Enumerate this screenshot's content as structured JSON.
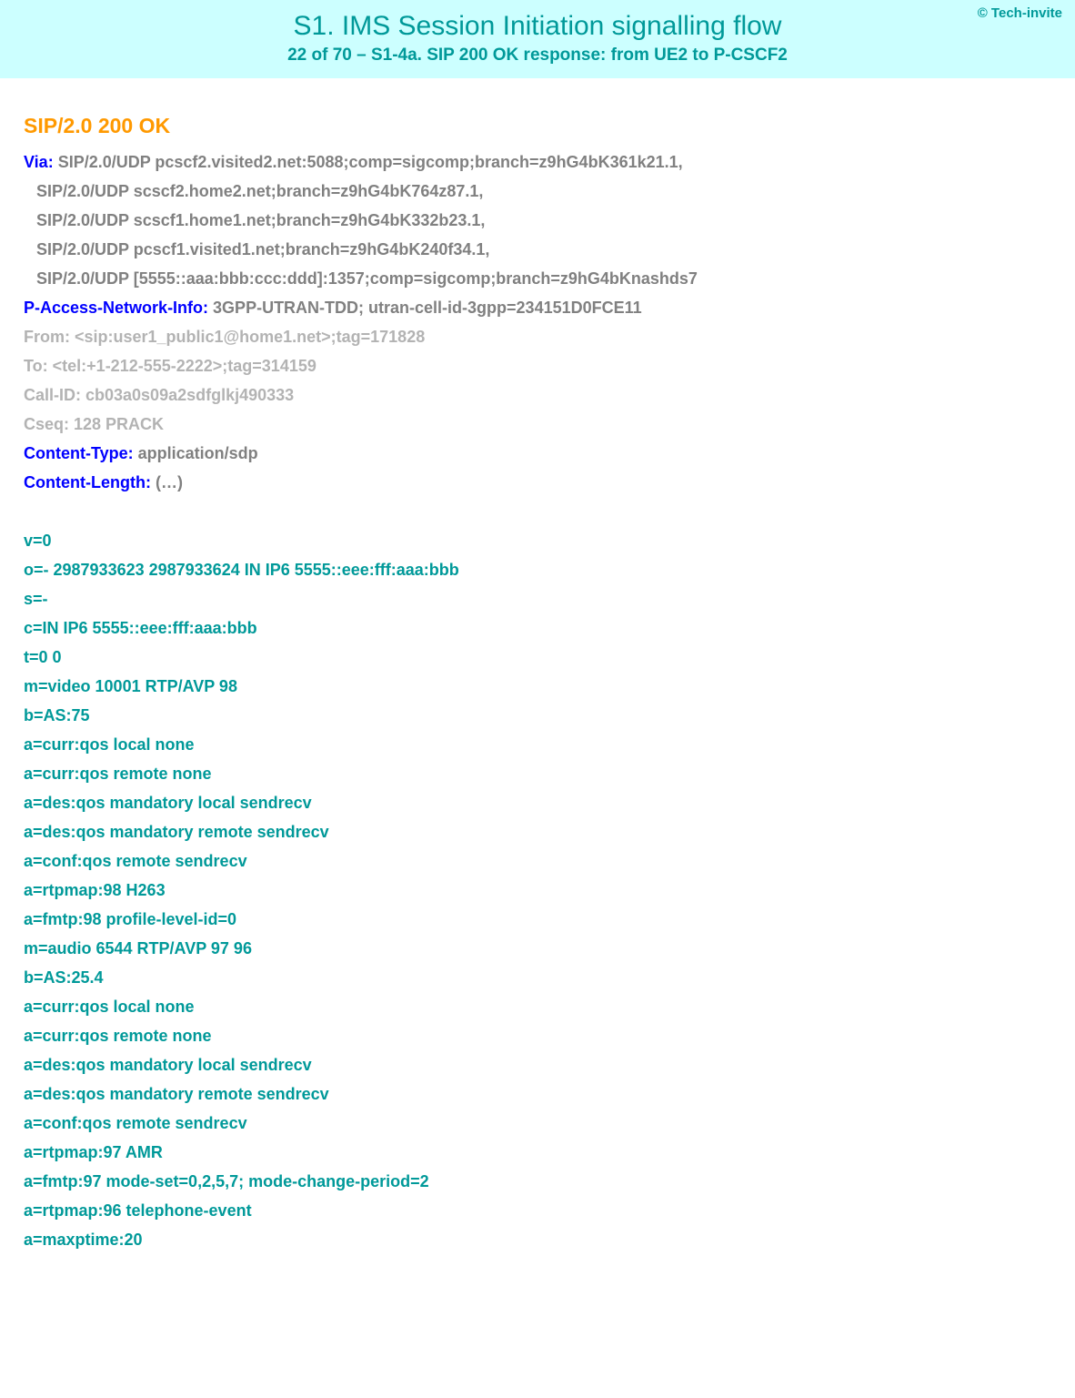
{
  "header": {
    "copyright": "© Tech-invite",
    "title": "S1. IMS Session Initiation signalling flow",
    "subtitle": "22 of 70 – S1-4a. SIP 200 OK response: from UE2 to P-CSCF2"
  },
  "sip": {
    "status_line": "SIP/2.0 200 OK",
    "via_label": "Via:",
    "via_first_value": " SIP/2.0/UDP pcscf2.visited2.net:5088;comp=sigcomp;branch=z9hG4bK361k21.1,",
    "via_cont": [
      "SIP/2.0/UDP scscf2.home2.net;branch=z9hG4bK764z87.1,",
      "SIP/2.0/UDP scscf1.home1.net;branch=z9hG4bK332b23.1,",
      "SIP/2.0/UDP pcscf1.visited1.net;branch=z9hG4bK240f34.1,",
      "SIP/2.0/UDP [5555::aaa:bbb:ccc:ddd]:1357;comp=sigcomp;branch=z9hG4bKnashds7"
    ],
    "pani_label": "P-Access-Network-Info:",
    "pani_value": " 3GPP-UTRAN-TDD; utran-cell-id-3gpp=234151D0FCE11",
    "from_label": "From:",
    "from_value": " <sip:user1_public1@home1.net>;tag=171828",
    "to_label": "To:",
    "to_value": " <tel:+1-212-555-2222>;tag=314159",
    "callid_label": "Call-ID:",
    "callid_value": " cb03a0s09a2sdfglkj490333",
    "cseq_label": "Cseq:",
    "cseq_value": " 128 PRACK",
    "ctype_label": "Content-Type:",
    "ctype_value": " application/sdp",
    "clen_label": "Content-Length:",
    "clen_value": " (…)"
  },
  "sdp": [
    "v=0",
    "o=- 2987933623 2987933624 IN IP6 5555::eee:fff:aaa:bbb",
    "s=-",
    "c=IN IP6 5555::eee:fff:aaa:bbb",
    "t=0 0",
    "m=video 10001 RTP/AVP 98",
    "b=AS:75",
    "a=curr:qos local none",
    "a=curr:qos remote none",
    "a=des:qos mandatory local sendrecv",
    "a=des:qos mandatory remote sendrecv",
    "a=conf:qos remote sendrecv",
    "a=rtpmap:98 H263",
    "a=fmtp:98 profile-level-id=0",
    "m=audio 6544 RTP/AVP 97 96",
    "b=AS:25.4",
    "a=curr:qos local none",
    "a=curr:qos remote none",
    "a=des:qos mandatory local sendrecv",
    "a=des:qos mandatory remote sendrecv",
    "a=conf:qos remote sendrecv",
    "a=rtpmap:97 AMR",
    "a=fmtp:97 mode-set=0,2,5,7; mode-change-period=2",
    "a=rtpmap:96 telephone-event",
    "a=maxptime:20"
  ]
}
